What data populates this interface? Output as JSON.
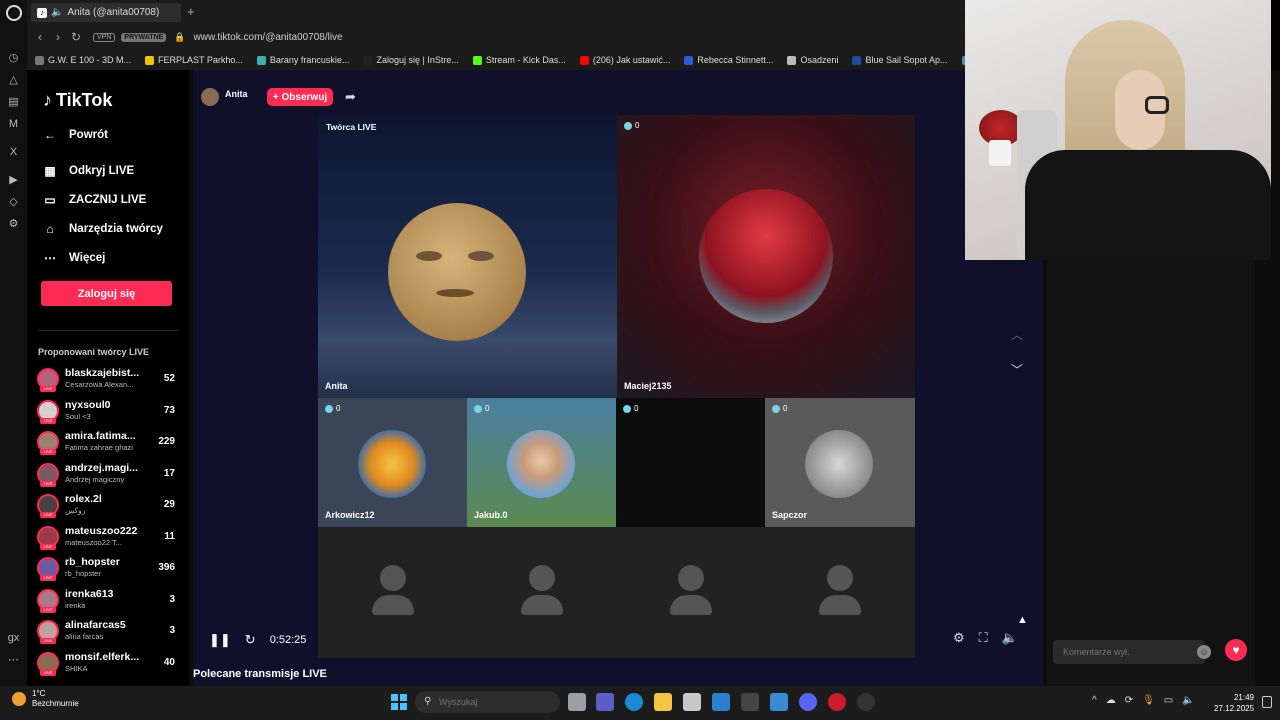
{
  "browser": {
    "tab_title": "Anita (@anita00708) ",
    "new_tab": "+",
    "vpn_label": "VPN",
    "private_label": "PRYWATNE",
    "url": "www.tiktok.com/@anita00708/live",
    "bookmarks": [
      {
        "label": "G.W. E 100 - 3D M...",
        "color": "#777777"
      },
      {
        "label": "FERPLAST Parkho...",
        "color": "#f2c200"
      },
      {
        "label": "Barany francuskie...",
        "color": "#3ab0a8"
      },
      {
        "label": "Zaloguj się | InStre...",
        "color": "#222222"
      },
      {
        "label": "Stream - Kick Das...",
        "color": "#53fc18"
      },
      {
        "label": "(206) Jak ustawić...",
        "color": "#ff0000"
      },
      {
        "label": "Rebecca Stinnett...",
        "color": "#2a5bd7"
      },
      {
        "label": "Osadzeni",
        "color": "#bbbbbb"
      },
      {
        "label": "Blue Sail Sopot Ap...",
        "color": "#1c4ea0"
      },
      {
        "label": "Matura mate",
        "color": "#4a8fa8"
      }
    ]
  },
  "sidebar": {
    "logo": "TikTok",
    "back": "Powrót",
    "items": [
      {
        "icon": "calendar-icon",
        "label": "Odkryj LIVE"
      },
      {
        "icon": "camera-icon",
        "label": "ZACZNIJ LIVE"
      },
      {
        "icon": "home-icon",
        "label": "Narzędzia twórcy"
      },
      {
        "icon": "more-icon",
        "label": "Więcej"
      }
    ],
    "login": "Zaloguj się",
    "suggested_title": "Proponowani twórcy LIVE",
    "creators": [
      {
        "name": "blaskzajebist...",
        "sub": "Cesarzowa Alexan...",
        "count": "52"
      },
      {
        "name": "nyxsoul0",
        "sub": "Soul <3",
        "count": "73"
      },
      {
        "name": "amira.fatima...",
        "sub": "Fatima zahrae ghazi",
        "count": "229"
      },
      {
        "name": "andrzej.magi...",
        "sub": "Andrzej magiczny",
        "count": "17"
      },
      {
        "name": "rolex.2l",
        "sub": "روكس",
        "count": "29"
      },
      {
        "name": "mateuszoo222",
        "sub": "mateuszoo22 T...",
        "count": "11"
      },
      {
        "name": "rb_hopster",
        "sub": "rb_hopster",
        "count": "396"
      },
      {
        "name": "irenka613",
        "sub": "irenka",
        "count": "3"
      },
      {
        "name": "alinafarcas5",
        "sub": "alina farcas",
        "count": "3"
      },
      {
        "name": "monsif.elferk...",
        "sub": "SHIKA",
        "count": "40"
      }
    ]
  },
  "stream": {
    "host": "Anita",
    "follow": "+ Obserwuj",
    "live_creator": "Twórca LIVE",
    "host_tile_label": "Anita",
    "main_guest": {
      "name": "Maciej2135",
      "viewers": "0"
    },
    "guests": [
      {
        "name": "Arkowicz12",
        "viewers": "0"
      },
      {
        "name": "Jakub.0",
        "viewers": "0"
      },
      {
        "name": "",
        "viewers": "0"
      },
      {
        "name": "Sapczor",
        "viewers": "0"
      }
    ],
    "elapsed": "0:52:25",
    "recommended": "Polecane transmisje LIVE"
  },
  "chat": {
    "placeholder": "Komentarze wył."
  },
  "taskbar": {
    "temp": "1°C",
    "weather": "Bezchmurnie",
    "search": "Wyszukaj",
    "time": "21:49",
    "date": "27.12.2025"
  }
}
